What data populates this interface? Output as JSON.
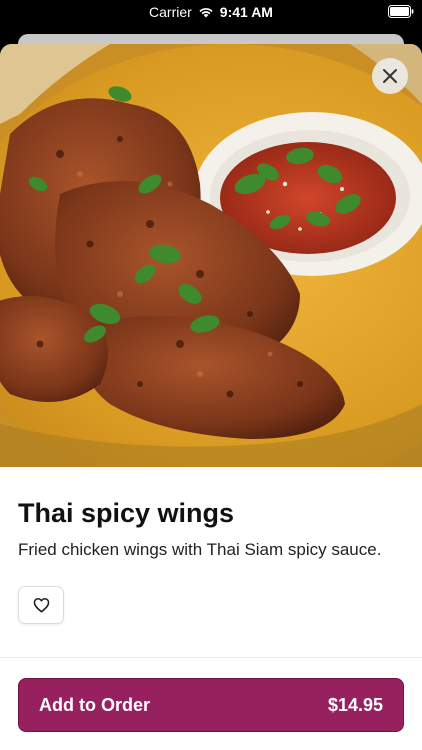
{
  "status_bar": {
    "carrier": "Carrier",
    "time": "9:41 AM",
    "wifi_icon": "wifi-icon",
    "battery_icon": "battery-icon"
  },
  "item": {
    "title": "Thai spicy wings",
    "description": "Fried chicken wings with Thai Siam spicy sauce.",
    "image_subject": "fried chicken wings with cilantro and dipping sauce on a yellow plate"
  },
  "controls": {
    "close_icon": "close-icon",
    "favorite_icon": "heart-icon"
  },
  "order": {
    "button_label": "Add to Order",
    "price": "$14.95"
  },
  "colors": {
    "accent": "#97215f",
    "sheet_background": "#ffffff",
    "screen_background": "#000000"
  }
}
